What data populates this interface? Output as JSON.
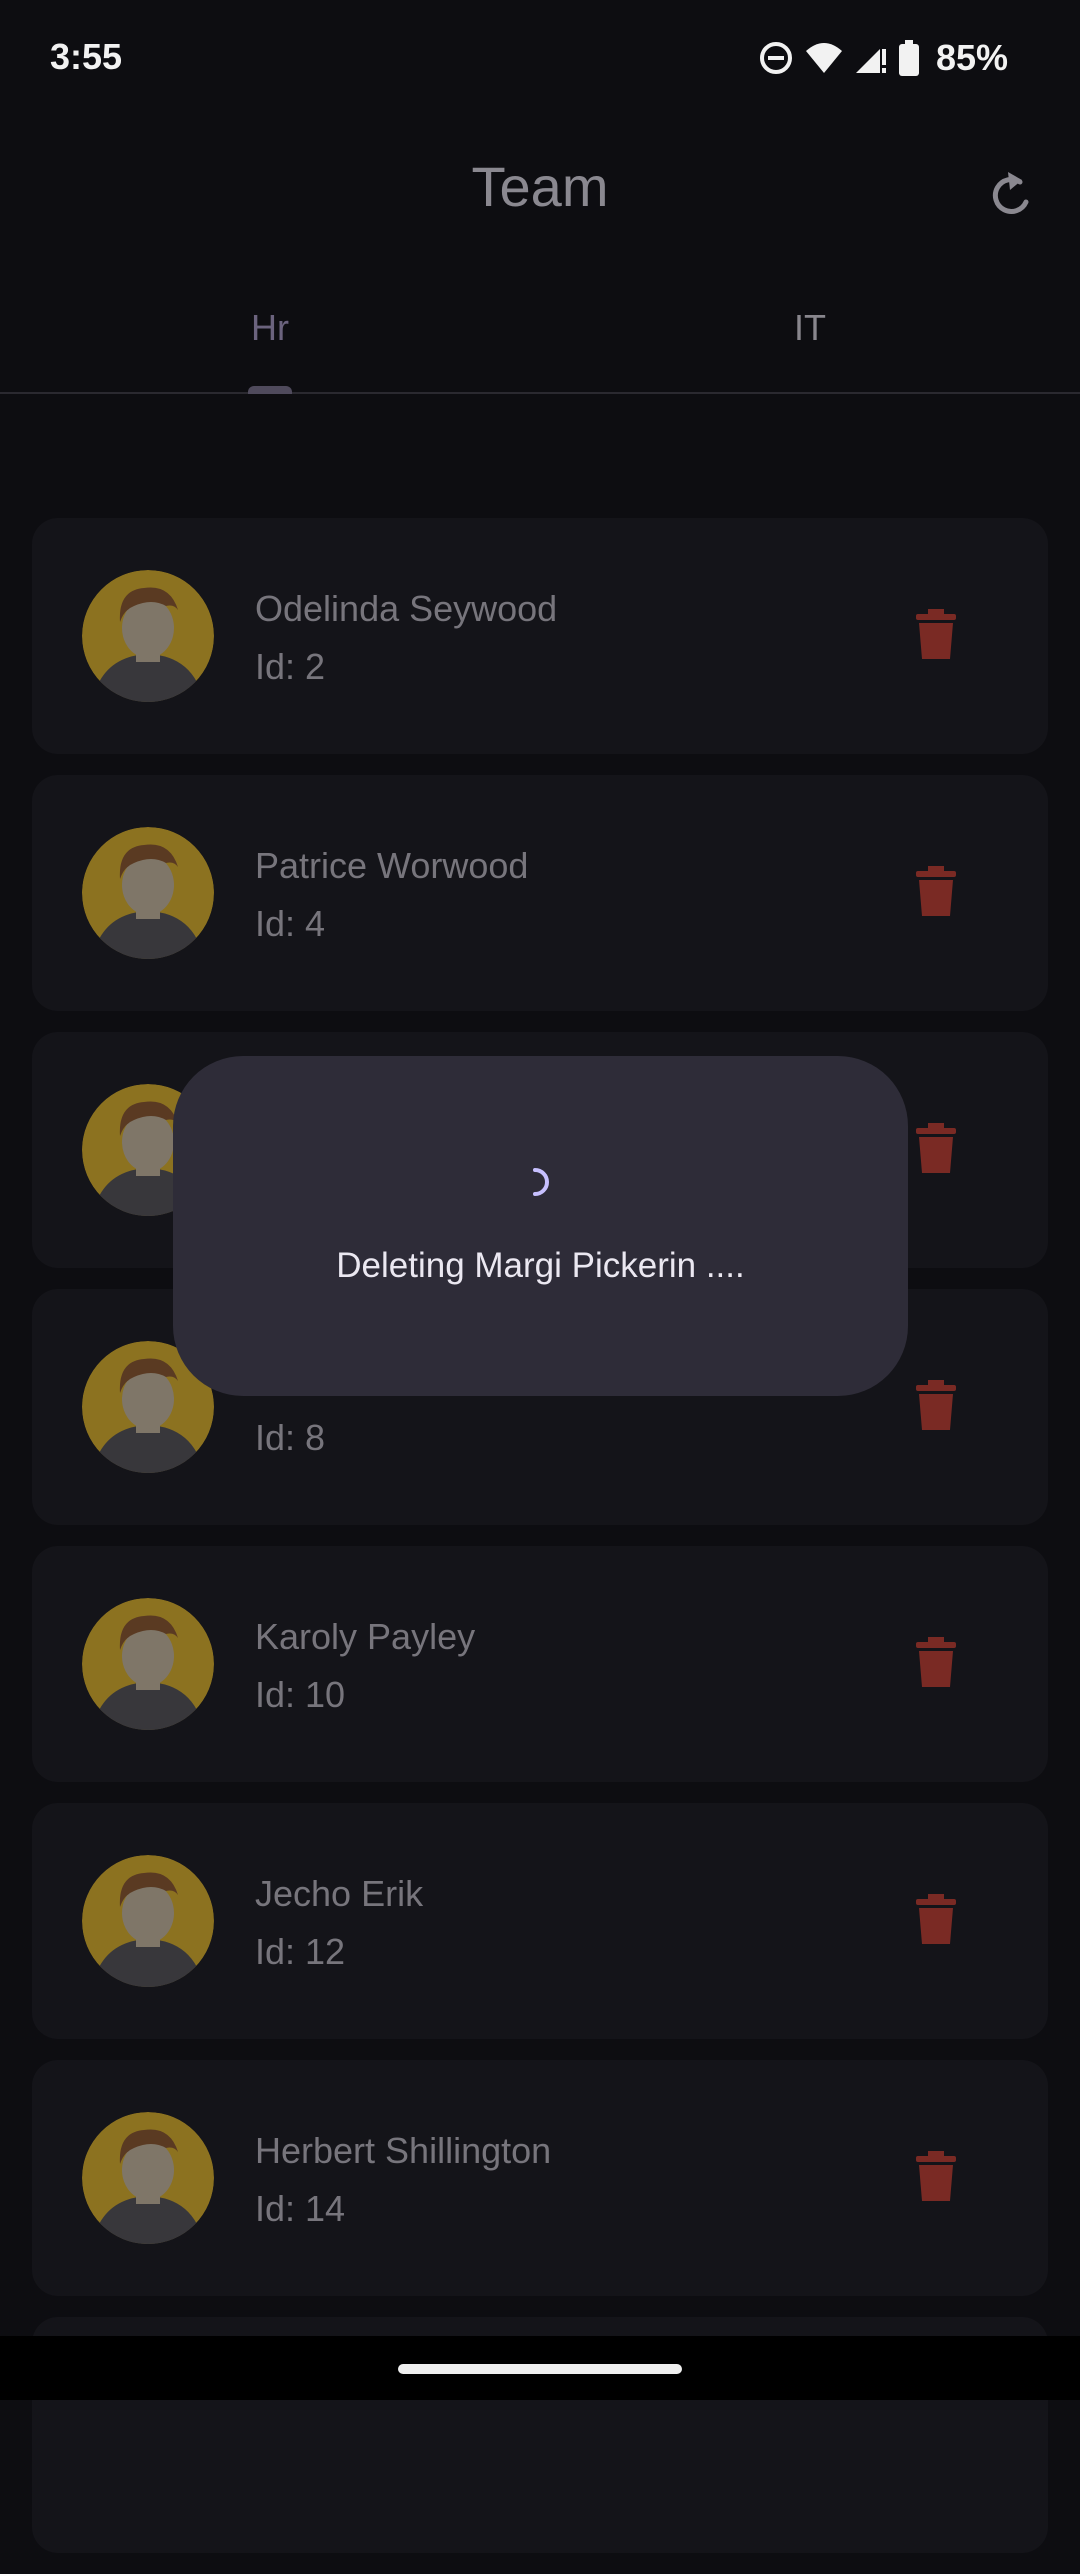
{
  "status_bar": {
    "time": "3:55",
    "battery": "85%",
    "icons": [
      "do-not-disturb-icon",
      "wifi-icon",
      "signal-icon",
      "battery-icon"
    ]
  },
  "app_bar": {
    "title": "Team",
    "refresh_icon": "refresh-icon"
  },
  "tabs": [
    {
      "label": "Hr",
      "selected": true
    },
    {
      "label": "IT",
      "selected": false
    }
  ],
  "employees": [
    {
      "name": "Odelinda Seywood",
      "id": "Id: 2"
    },
    {
      "name": "Patrice Worwood",
      "id": "Id: 4"
    },
    {
      "name": "",
      "id": ""
    },
    {
      "name": "",
      "id": "Id: 8"
    },
    {
      "name": "Karoly Payley",
      "id": "Id: 10"
    },
    {
      "name": "Jecho Erik",
      "id": "Id: 12"
    },
    {
      "name": "Herbert Shillington",
      "id": "Id: 14"
    }
  ],
  "dialog": {
    "message": "Deleting Margi Pickerin ...."
  },
  "colors": {
    "background": "#0d0d11",
    "card": "#141419",
    "dialog": "#2e2c38",
    "delete": "#7a2a24",
    "avatar_bg": "#8c7220",
    "spinner": "#c7c0ff"
  }
}
